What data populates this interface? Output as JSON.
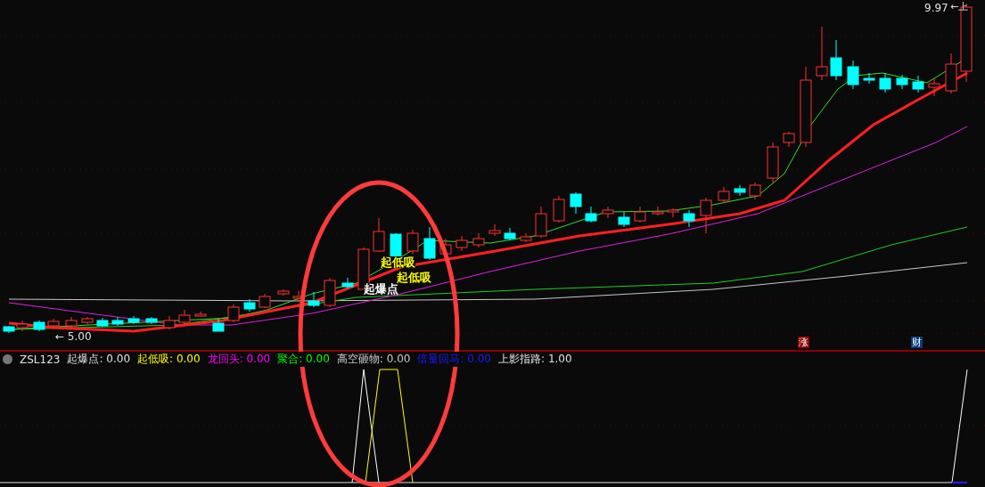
{
  "main_chart": {
    "high_label": "9.97",
    "high_arrow": "←上",
    "low_label": "← 5.00",
    "signals": [
      {
        "text": "起低吸",
        "color": "#ffff00"
      },
      {
        "text": "起低吸",
        "color": "#ffff00"
      },
      {
        "text": "起爆点",
        "color": "#ffffff"
      }
    ],
    "markers": [
      {
        "text": "涨",
        "color": "#8b0000"
      },
      {
        "text": "财",
        "color": "#0b3c78"
      }
    ]
  },
  "indicator": {
    "name": "ZSL123",
    "items": [
      {
        "label": "起爆点:",
        "value": "0.00",
        "color": "#e0e0e0"
      },
      {
        "label": "起低吸:",
        "value": "0.00",
        "color": "#ffff00"
      },
      {
        "label": "龙回头:",
        "value": "0.00",
        "color": "#ff00ff"
      },
      {
        "label": "聚合:",
        "value": "0.00",
        "color": "#00ff00"
      },
      {
        "label": "高空砸物:",
        "value": "0.00",
        "color": "#c8c8c8"
      },
      {
        "label": "倍量回马:",
        "value": "0.00",
        "color": "#1a1aff"
      },
      {
        "label": "上影指路:",
        "value": "1.00",
        "color": "#e0e0e0"
      }
    ]
  }
}
